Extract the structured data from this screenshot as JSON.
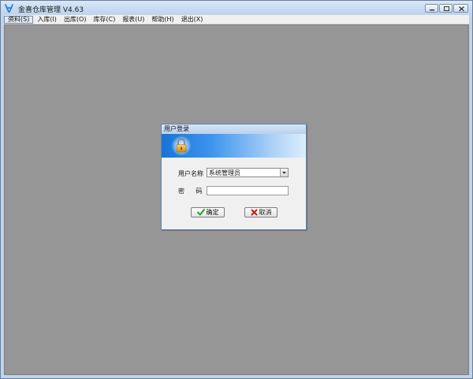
{
  "window": {
    "title": "金喜仓库管理 V4.63"
  },
  "menu": {
    "items": [
      {
        "label": "资料(S)"
      },
      {
        "label": "入库(I)"
      },
      {
        "label": "出库(O)"
      },
      {
        "label": "库存(C)"
      },
      {
        "label": "报表(U)"
      },
      {
        "label": "帮助(H)"
      },
      {
        "label": "退出(X)"
      }
    ]
  },
  "login_dialog": {
    "title": "用户登录",
    "username_label": "用户名称",
    "username_value": "系统管理员",
    "password_label": "密 码",
    "password_value": "",
    "ok_label": "确定",
    "cancel_label": "取消"
  },
  "colors": {
    "mdi_background": "#969696",
    "banner_start": "#1673d6",
    "banner_end": "#ddeefc",
    "ok_check": "#2c9a23",
    "cancel_x": "#d0161b"
  },
  "icons": {
    "app": "app-logo-icon",
    "lock": "padlock-icon",
    "ok": "checkmark-icon",
    "cancel": "red-x-icon"
  }
}
